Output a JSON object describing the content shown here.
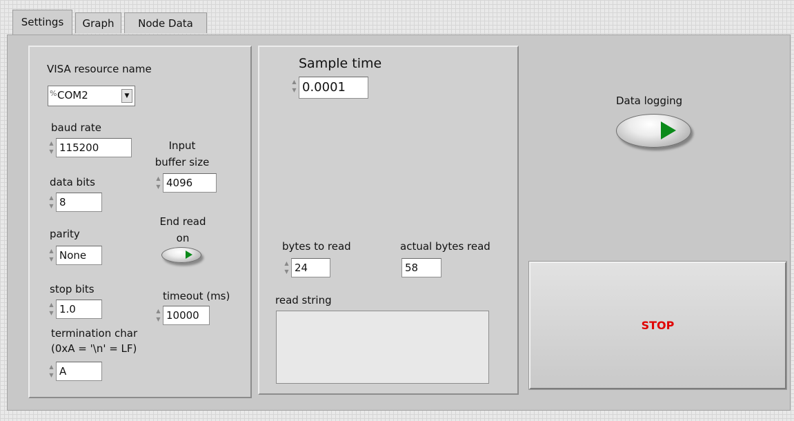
{
  "tabs": [
    "Settings",
    "Graph",
    "Node Data"
  ],
  "settings": {
    "visa_label": "VISA resource name",
    "visa_value": "COM2",
    "visa_icon": "%",
    "baud_label": "baud rate",
    "baud_value": "115200",
    "databits_label": "data bits",
    "databits_value": "8",
    "parity_label": "parity",
    "parity_value": "None",
    "stopbits_label": "stop bits",
    "stopbits_value": "1.0",
    "term_label_line1": "termination char",
    "term_label_line2": "(0xA = '\\n' = LF)",
    "term_value": "A",
    "inbuf_label_line1": "Input",
    "inbuf_label_line2": "buffer size",
    "inbuf_value": "4096",
    "endread_label_line1": "End read",
    "endread_label_line2": "on",
    "endread_state": true,
    "timeout_label": "timeout (ms)",
    "timeout_value": "10000"
  },
  "middle": {
    "sample_label": "Sample time",
    "sample_value": "0.0001",
    "bytes_to_read_label": "bytes to read",
    "bytes_to_read_value": "24",
    "actual_bytes_label": "actual bytes read",
    "actual_bytes_value": "58",
    "read_string_label": "read string",
    "read_string_value": ""
  },
  "right": {
    "logging_label": "Data logging",
    "logging_state": true,
    "stop_label": "STOP"
  },
  "colors": {
    "led_green": "#0b8a1a",
    "stop_text": "#e00000"
  }
}
